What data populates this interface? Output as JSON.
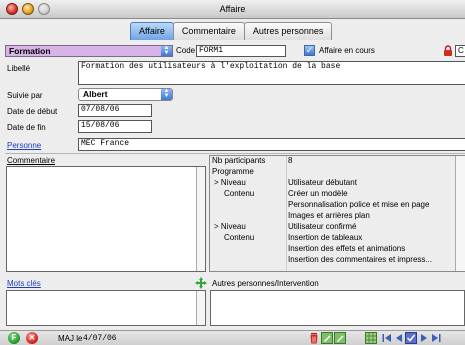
{
  "window": {
    "title": "Affaire"
  },
  "tabs": [
    {
      "label": "Affaire",
      "active": true
    },
    {
      "label": "Commentaire",
      "active": false
    },
    {
      "label": "Autres personnes",
      "active": false
    }
  ],
  "header": {
    "type_value": "Formation",
    "code_label": "Code",
    "code_value": "FORM1",
    "encours_label": "Affaire en cours",
    "encours_checked": true,
    "right_field_value": "C"
  },
  "form": {
    "libelle_label": "Libellé",
    "libelle_value": "Formation des utilisateurs à l'exploitation de la base",
    "suivie_label": "Suivie par",
    "suivie_value": "Albert",
    "debut_label": "Date de début",
    "debut_value": "07/08/06",
    "fin_label": "Date de fin",
    "fin_value": "15/08/06",
    "personne_label": "Personne",
    "personne_value": "MEC France"
  },
  "commentaire": {
    "label": "Commentaire"
  },
  "details": {
    "nb_label": "Nb participants",
    "nb_value": "8",
    "programme_label": "Programme",
    "rows": [
      {
        "key": "> Niveau",
        "value": "Utilisateur débutant"
      },
      {
        "key": "Contenu",
        "value": "Créer un modèle"
      },
      {
        "key": "",
        "value": "Personnalisation police et mise en page"
      },
      {
        "key": "",
        "value": "Images et arrières plan"
      },
      {
        "key": "> Niveau",
        "value": "Utilisateur confirmé"
      },
      {
        "key": "Contenu",
        "value": "Insertion de tableaux"
      },
      {
        "key": "",
        "value": "Insertion des effets et animations"
      },
      {
        "key": "",
        "value": "Insertion des commentaires et impress..."
      }
    ]
  },
  "bottom": {
    "motscles_label": "Mots clés",
    "autres_label": "Autres personnes/Intervention"
  },
  "status": {
    "f_label": "F",
    "x_label": "✕",
    "maj_label": "MAJ le",
    "maj_date": "4/07/06"
  },
  "colors": {
    "type_bg": "#d7b3e8",
    "active_tab": "#6fa4e6",
    "link": "#1a3fbf"
  }
}
